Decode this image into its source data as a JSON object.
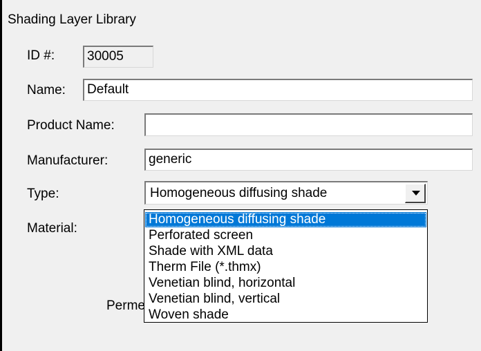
{
  "title": "Shading Layer Library",
  "id_label": "ID #:",
  "id_value": "30005",
  "name_label": "Name:",
  "name_value": "Default",
  "product_name_label": "Product Name:",
  "product_name_value": "",
  "manufacturer_label": "Manufacturer:",
  "manufacturer_value": "generic",
  "type_label": "Type:",
  "type_value": "Homogeneous diffusing shade",
  "material_label": "Material:",
  "permeability_label_partial": "Perme",
  "type_options": [
    "Homogeneous diffusing shade",
    "Perforated screen",
    "Shade with XML data",
    "Therm File (*.thmx)",
    "Venetian blind, horizontal",
    "Venetian blind, vertical",
    "Woven shade"
  ],
  "selected_option_index": 0,
  "icons": {
    "dropdown_button": "chevron-down-icon"
  }
}
